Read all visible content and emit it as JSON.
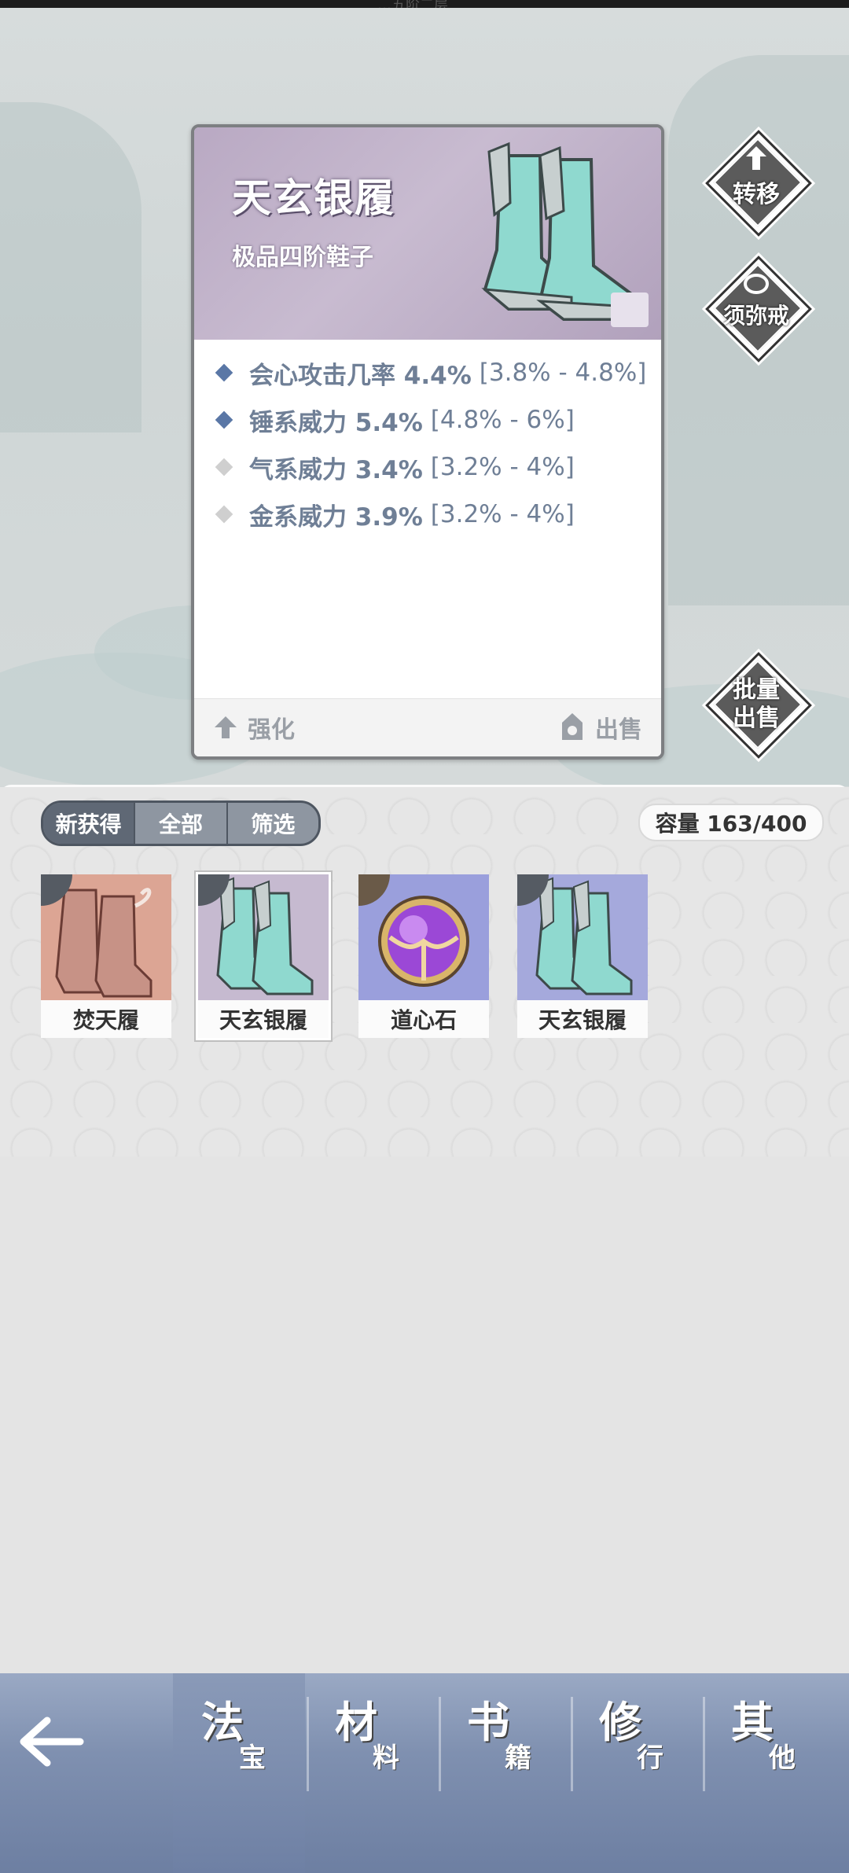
{
  "status": {
    "top_text": "…五阶二层"
  },
  "detail": {
    "title": "天玄银履",
    "subtitle": "极品四阶鞋子",
    "stats": [
      {
        "label": "会心攻击几率 4.4%",
        "range": "[3.8% - 4.8%]",
        "tier": "blue"
      },
      {
        "label": "锤系威力 5.4%",
        "range": "[4.8% - 6%]",
        "tier": "blue"
      },
      {
        "label": "气系威力 3.4%",
        "range": "[3.2% - 4%]",
        "tier": "grey"
      },
      {
        "label": "金系威力 3.9%",
        "range": "[3.2% - 4%]",
        "tier": "grey"
      }
    ],
    "upgrade_label": "强化",
    "sell_label": "出售"
  },
  "side_buttons": {
    "transfer": "转移",
    "ring": "须弥戒",
    "batch_sell_1": "批量",
    "batch_sell_2": "出售"
  },
  "filters": {
    "tabs": [
      "新获得",
      "全部",
      "筛选"
    ]
  },
  "capacity": "容量 163/400",
  "items": [
    {
      "name": "焚天履",
      "bg": "#dca594"
    },
    {
      "name": "天玄银履",
      "bg": "#c6bad0"
    },
    {
      "name": "道心石",
      "bg": "#9a9fdc"
    },
    {
      "name": "天玄银履",
      "bg": "#a5a9dc"
    }
  ],
  "nav": {
    "tabs": [
      {
        "big": "法",
        "small": "宝"
      },
      {
        "big": "材",
        "small": "料"
      },
      {
        "big": "书",
        "small": "籍"
      },
      {
        "big": "修",
        "small": "行"
      },
      {
        "big": "其",
        "small": "他"
      }
    ]
  },
  "colors": {
    "stat_text": "#6f7f96",
    "nav_bg": "#7f90b0",
    "card_head": "#c2b5cc"
  }
}
